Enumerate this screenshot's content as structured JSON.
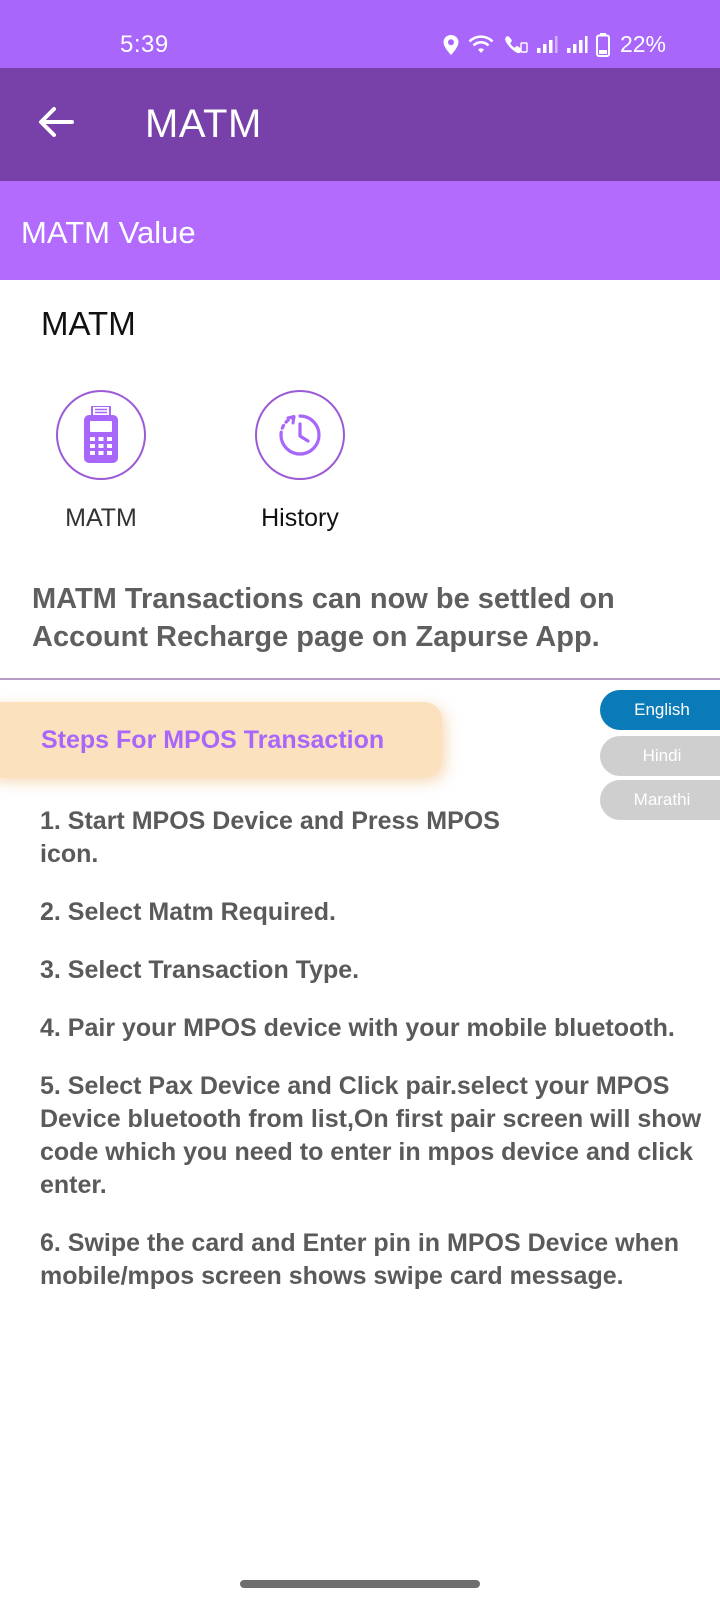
{
  "status_bar": {
    "time": "5:39",
    "battery": "22%",
    "icons": [
      "location-icon",
      "wifi-icon",
      "wifi-call-icon",
      "signal-icon",
      "signal-icon",
      "battery-icon"
    ]
  },
  "app_bar": {
    "title": "MATM",
    "back_icon": "arrow-left-icon"
  },
  "section_header": {
    "label": "MATM Value"
  },
  "main": {
    "heading": "MATM",
    "tiles": [
      {
        "label": "MATM",
        "icon": "pos-terminal-icon"
      },
      {
        "label": "History",
        "icon": "history-clock-icon"
      }
    ],
    "notice": "MATM Transactions can now be settled on Account Recharge page on Zapurse App."
  },
  "steps_section": {
    "title": "Steps For MPOS Transaction",
    "languages": [
      {
        "label": "English",
        "selected": true
      },
      {
        "label": "Hindi",
        "selected": false
      },
      {
        "label": "Marathi",
        "selected": false
      }
    ],
    "steps": [
      "1. Start MPOS Device and Press MPOS icon.",
      "2. Select Matm Required.",
      "3. Select Transaction Type.",
      "4. Pair your MPOS device with your mobile bluetooth.",
      "5. Select Pax Device and Click pair.select your MPOS Device bluetooth from list,On first pair screen will show code which you need to enter in mpos device and click enter.",
      "6. Swipe the card and Enter pin in MPOS Device when mobile/mpos screen shows swipe card message."
    ]
  },
  "colors": {
    "status_bar": "#a866fb",
    "app_bar": "#7741a9",
    "section_header": "#b26bfd",
    "accent": "#a866fb",
    "selected_language": "#0a7ab8",
    "unselected_language": "#cfcfcf",
    "steps_pill": "#fbe1bd"
  }
}
